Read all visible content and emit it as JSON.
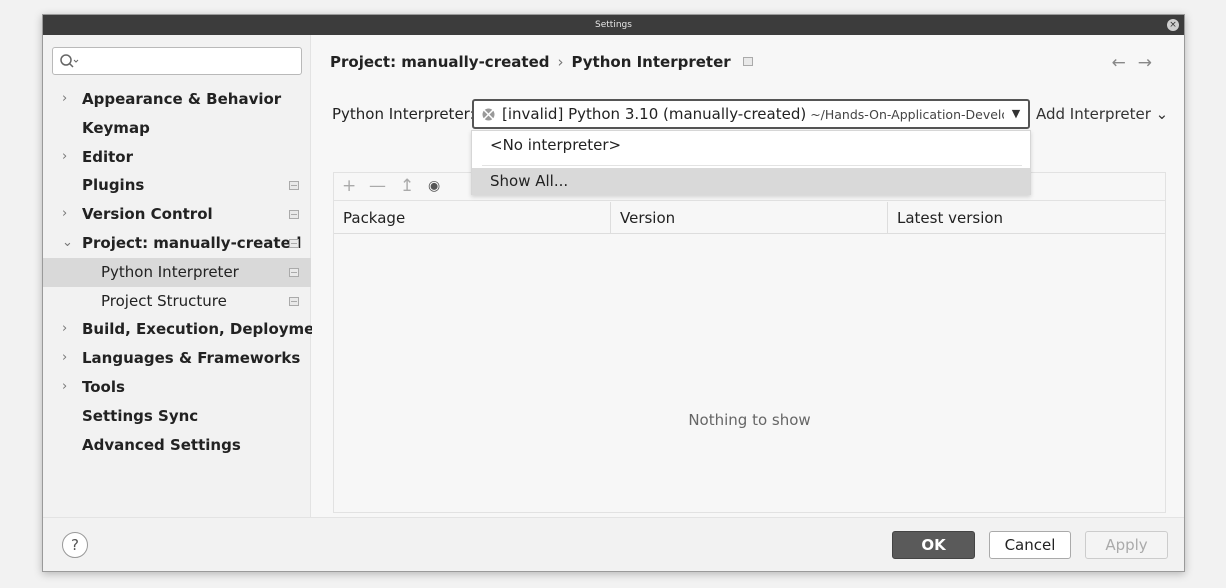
{
  "window": {
    "title": "Settings"
  },
  "sidebar": {
    "search": {
      "value": "",
      "placeholder": ""
    },
    "items": [
      {
        "label": "Appearance & Behavior",
        "chevron": "›",
        "badge": false
      },
      {
        "label": "Keymap",
        "chevron": "",
        "badge": false
      },
      {
        "label": "Editor",
        "chevron": "›",
        "badge": false
      },
      {
        "label": "Plugins",
        "chevron": "",
        "badge": true
      },
      {
        "label": "Version Control",
        "chevron": "›",
        "badge": true
      },
      {
        "label": "Project: manually-created",
        "chevron": "⌄",
        "badge": true
      },
      {
        "label": "Python Interpreter",
        "chevron": "",
        "badge": true,
        "sub": true,
        "selected": true
      },
      {
        "label": "Project Structure",
        "chevron": "",
        "badge": true,
        "sub": true
      },
      {
        "label": "Build, Execution, Deployment",
        "chevron": "›",
        "badge": false
      },
      {
        "label": "Languages & Frameworks",
        "chevron": "›",
        "badge": false
      },
      {
        "label": "Tools",
        "chevron": "›",
        "badge": false
      },
      {
        "label": "Settings Sync",
        "chevron": "",
        "badge": false
      },
      {
        "label": "Advanced Settings",
        "chevron": "",
        "badge": false
      }
    ]
  },
  "main": {
    "breadcrumb": {
      "project": "Project: manually-created",
      "separator": "›",
      "page": "Python Interpreter"
    },
    "nav": {
      "back": "←",
      "forward": "→"
    },
    "interpreter_label": "Python Interpreter:",
    "interpreter_value": "[invalid] Python 3.10 (manually-created)",
    "interpreter_path": " ~/Hands-On-Application-Development",
    "add_interpreter": "Add Interpreter ⌄",
    "toolbar": {
      "add": "+",
      "remove": "—",
      "upgrade": "↥",
      "show": "👁"
    },
    "columns": [
      "Package",
      "Version",
      "Latest version"
    ],
    "empty_text": "Nothing to show",
    "dropdown": {
      "no_interpreter": "<No interpreter>",
      "show_all": "Show All..."
    }
  },
  "footer": {
    "help": "?",
    "ok": "OK",
    "cancel": "Cancel",
    "apply": "Apply"
  },
  "colors": {
    "selected_bg": "#d9d9d9",
    "ok_bg": "#5a5a5a",
    "titlebar": "#3c3c3c"
  }
}
